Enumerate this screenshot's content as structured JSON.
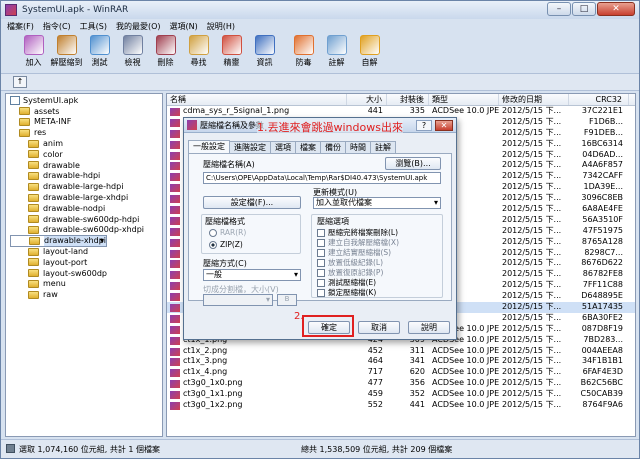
{
  "window": {
    "title": "SystemUI.apk - WinRAR",
    "min": "–",
    "max": "□",
    "close": "✕"
  },
  "menu": [
    "檔案(F)",
    "指令(C)",
    "工具(S)",
    "我的最愛(O)",
    "選項(N)",
    "說明(H)"
  ],
  "toolbar": [
    {
      "label": "加入",
      "color": "#b060c0"
    },
    {
      "label": "解壓縮到",
      "color": "#c08030"
    },
    {
      "label": "測試",
      "color": "#5090d0"
    },
    {
      "label": "檢視",
      "color": "#7080a0"
    },
    {
      "label": "刪除",
      "color": "#a04050"
    },
    {
      "label": "尋找",
      "color": "#d0a040"
    },
    {
      "label": "精靈",
      "color": "#d05040"
    },
    {
      "label": "資訊",
      "color": "#4070c0"
    },
    {
      "label": "防毒",
      "color": "#e07030"
    },
    {
      "label": "註解",
      "color": "#70a0d0"
    },
    {
      "label": "自解",
      "color": "#e0a020"
    }
  ],
  "tree": {
    "root": "SystemUI.apk",
    "items": [
      {
        "label": "assets",
        "indent": 1
      },
      {
        "label": "META-INF",
        "indent": 1
      },
      {
        "label": "res",
        "indent": 1
      },
      {
        "label": "anim",
        "indent": 2
      },
      {
        "label": "color",
        "indent": 2
      },
      {
        "label": "drawable",
        "indent": 2
      },
      {
        "label": "drawable-hdpi",
        "indent": 2
      },
      {
        "label": "drawable-large-hdpi",
        "indent": 2
      },
      {
        "label": "drawable-large-xhdpi",
        "indent": 2
      },
      {
        "label": "drawable-nodpi",
        "indent": 2
      },
      {
        "label": "drawable-sw600dp-hdpi",
        "indent": 2
      },
      {
        "label": "drawable-sw600dp-xhdpi",
        "indent": 2
      },
      {
        "label": "drawable-xhdpi",
        "indent": 2
      },
      {
        "label": "layout",
        "indent": 2
      },
      {
        "label": "layout-land",
        "indent": 2
      },
      {
        "label": "layout-port",
        "indent": 2
      },
      {
        "label": "layout-sw600dp",
        "indent": 2
      },
      {
        "label": "menu",
        "indent": 2
      },
      {
        "label": "raw",
        "indent": 2
      }
    ]
  },
  "list": {
    "headers": [
      "名稱",
      "大小",
      "封裝後",
      "類型",
      "修改的日期",
      "CRC32"
    ],
    "rows": [
      [
        "cdma_sys_r_5signal_1.png",
        "441",
        "335",
        "ACDSee 10.0 JPEG",
        "2012/5/15 下...",
        "37C221E1"
      ],
      [
        "",
        "",
        "",
        "",
        "2012/5/15 下...",
        "F1D6B..."
      ],
      [
        "",
        "",
        "",
        "",
        "2012/5/15 下...",
        "F91DEB..."
      ],
      [
        "",
        "",
        "",
        "",
        "2012/5/15 下...",
        "16BC6314"
      ],
      [
        "",
        "",
        "",
        "",
        "2012/5/15 下...",
        "04D6AD..."
      ],
      [
        "",
        "",
        "",
        "",
        "2012/5/15 下...",
        "A4A6F857"
      ],
      [
        "",
        "",
        "",
        "",
        "2012/5/15 下...",
        "7342CAFF"
      ],
      [
        "",
        "",
        "",
        "",
        "2012/5/15 下...",
        "1DA39E..."
      ],
      [
        "",
        "",
        "",
        "",
        "2012/5/15 下...",
        "3096C8EB"
      ],
      [
        "",
        "",
        "",
        "",
        "2012/5/15 下...",
        "6A8AE4FE"
      ],
      [
        "",
        "",
        "",
        "",
        "2012/5/15 下...",
        "56A3510F"
      ],
      [
        "",
        "",
        "",
        "",
        "2012/5/15 下...",
        "47F51975"
      ],
      [
        "",
        "",
        "",
        "",
        "2012/5/15 下...",
        "8765A128"
      ],
      [
        "",
        "",
        "",
        "",
        "2012/5/15 下...",
        "8298C7..."
      ],
      [
        "",
        "",
        "",
        "",
        "2012/5/15 下...",
        "8676D622"
      ],
      [
        "",
        "",
        "",
        "",
        "2012/5/15 下...",
        "86782FE8"
      ],
      [
        "",
        "",
        "",
        "",
        "2012/5/15 下...",
        "7FF11C88"
      ],
      [
        "",
        "",
        "",
        "",
        "2012/5/15 下...",
        "D648895E"
      ],
      [
        "",
        "",
        "",
        "",
        "2012/5/15 下...",
        "51A17435"
      ],
      [
        "",
        "",
        "",
        "",
        "2012/5/15 下...",
        "6BA30FE2"
      ],
      [
        "ct1x_0.png",
        "404",
        "294",
        "ACDSee 10.0 JPEG",
        "2012/5/15 下...",
        "087D8F19"
      ],
      [
        "ct1x_1.png",
        "424",
        "309",
        "ACDSee 10.0 JPEG",
        "2012/5/15 下...",
        "7BD283..."
      ],
      [
        "ct1x_2.png",
        "452",
        "311",
        "ACDSee 10.0 JPEG",
        "2012/5/15 下...",
        "004AEEA8"
      ],
      [
        "ct1x_3.png",
        "464",
        "341",
        "ACDSee 10.0 JPEG",
        "2012/5/15 下...",
        "34F1B1B1"
      ],
      [
        "ct1x_4.png",
        "717",
        "620",
        "ACDSee 10.0 JPEG",
        "2012/5/15 下...",
        "6FAF4E3D"
      ],
      [
        "ct3g0_1x0.png",
        "477",
        "356",
        "ACDSee 10.0 JPEG",
        "2012/5/15 下...",
        "B62C56BC"
      ],
      [
        "ct3g0_1x1.png",
        "459",
        "352",
        "ACDSee 10.0 JPEG",
        "2012/5/15 下...",
        "C50CAB39"
      ],
      [
        "ct3g0_1x2.png",
        "552",
        "441",
        "ACDSee 10.0 JPEG",
        "2012/5/15 下...",
        "8764F9A6"
      ]
    ]
  },
  "status": {
    "left": "選取 1,074,160 位元組, 共計 1 個檔案",
    "right": "總共 1,538,509 位元組, 共計 209 個檔案"
  },
  "dialog": {
    "title": "壓縮檔名稱及參數",
    "help": "?",
    "close": "✕",
    "tabs": [
      "一般設定",
      "進階設定",
      "選項",
      "檔案",
      "備份",
      "時間",
      "註解"
    ],
    "archive_name_label": "壓縮檔名稱(A)",
    "browse": "瀏覽(B)...",
    "path": "C:\\Users\\OPE\\AppData\\Local\\Temp\\Rar$DI40.473\\SystemUI.apk",
    "profiles": "設定檔(F)...",
    "update_label": "更新模式(U)",
    "update_value": "加入並取代檔案",
    "format_label": "壓縮檔格式",
    "rar": "RAR(R)",
    "zip": "ZIP(Z)",
    "options_label": "壓縮選項",
    "checks": [
      "壓縮完將檔案刪除(L)",
      "建立自我解壓縮檔(X)",
      "建立結實壓縮檔(S)",
      "放置低級紀錄(L)",
      "放置復原記錄(P)",
      "測試壓縮檔(E)",
      "鎖定壓縮檔(K)"
    ],
    "method_label": "壓縮方式(C)",
    "method_value": "一般",
    "split_label": "切成分割檔，大小(V)",
    "split_unit": "B",
    "ok": "確定",
    "cancel": "取消",
    "help_btn": "說明"
  },
  "annotations": {
    "step1": "1.丟進來會跳過windows出來",
    "step2": "2."
  },
  "colors": {
    "highlight": "#e02020"
  }
}
